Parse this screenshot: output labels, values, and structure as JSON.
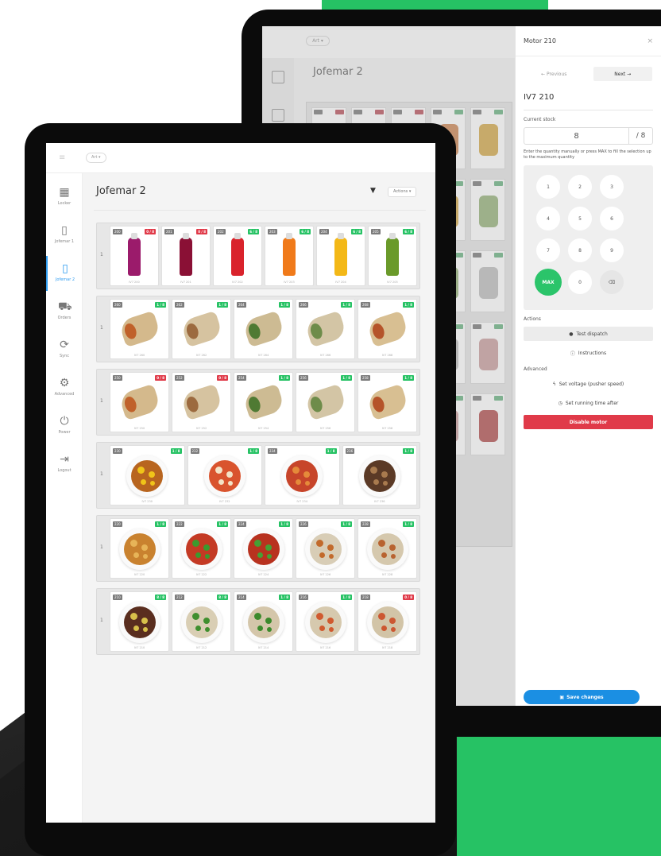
{
  "back_screen": {
    "location_pill": "Art ▾",
    "page_title": "Jofemar 2"
  },
  "drawer": {
    "title": "Motor 210",
    "close": "×",
    "previous": "← Previous",
    "next": "Next →",
    "motor_name": "IV7 210",
    "current_stock_label": "Current stock",
    "stock_value": "8",
    "stock_max": "/ 8",
    "help_text": "Enter the quantity manually or press MAX to fill the selection up to the maximum quantity",
    "keys": [
      "1",
      "2",
      "3",
      "4",
      "5",
      "6",
      "7",
      "8",
      "9",
      "MAX",
      "0",
      "⌫"
    ],
    "actions_label": "Actions",
    "test_dispatch": "Test dispatch",
    "instructions": "Instructions",
    "advanced_label": "Advanced",
    "set_voltage": "Set voltage (pusher speed)",
    "set_running_time": "Set running time after",
    "disable_motor": "Disable motor",
    "save_changes": "Save changes"
  },
  "front": {
    "location_pill": "Art ▾",
    "page_title": "Jofemar 2",
    "actions_button": "Actions ▾",
    "sidebar": [
      {
        "label": "Locker",
        "icon": "grid-icon",
        "glyph": "▦"
      },
      {
        "label": "Jofemar 1",
        "icon": "vending-icon",
        "glyph": "▯"
      },
      {
        "label": "Jofemar 2",
        "icon": "vending-icon",
        "glyph": "▯",
        "active": true
      },
      {
        "label": "Orders",
        "icon": "cart-icon",
        "glyph": "⛟"
      },
      {
        "label": "Sync",
        "icon": "sync-icon",
        "glyph": "⟳"
      },
      {
        "label": "Advanced",
        "icon": "gear-icon",
        "glyph": "⚙"
      },
      {
        "label": "Power",
        "icon": "power-icon",
        "glyph": "⏻"
      },
      {
        "label": "Logout",
        "icon": "logout-icon",
        "glyph": "⇥"
      }
    ],
    "rows": [
      {
        "number": "1",
        "cells": [
          {
            "id": "200",
            "stock": "0 / 8",
            "status": "red",
            "type": "bottle",
            "color": "#9b1b6b",
            "ref": "IV7 200"
          },
          {
            "id": "201",
            "stock": "0 / 8",
            "status": "red",
            "type": "bottle",
            "color": "#8a1035",
            "ref": "IV7 201"
          },
          {
            "id": "202",
            "stock": "6 / 8",
            "status": "green",
            "type": "bottle",
            "color": "#d9232c",
            "ref": "IV7 202"
          },
          {
            "id": "203",
            "stock": "6 / 8",
            "status": "green",
            "type": "bottle",
            "color": "#f07a1a",
            "ref": "IV7 203"
          },
          {
            "id": "204",
            "stock": "6 / 8",
            "status": "green",
            "type": "bottle",
            "color": "#f3b817",
            "ref": "IV7 204"
          },
          {
            "id": "205",
            "stock": "6 / 8",
            "status": "green",
            "type": "bottle",
            "color": "#6a9a2a",
            "ref": "IV7 205"
          }
        ]
      },
      {
        "number": "1",
        "cells": [
          {
            "id": "260",
            "stock": "1 / 8",
            "status": "green",
            "type": "wrap",
            "color": "#d4b98c",
            "fill": "#c0612a",
            "ref": "IV7 260"
          },
          {
            "id": "262",
            "stock": "1 / 8",
            "status": "green",
            "type": "wrap",
            "color": "#d6c3a0",
            "fill": "#9c6a3f",
            "ref": "IV7 262"
          },
          {
            "id": "264",
            "stock": "1 / 8",
            "status": "green",
            "type": "wrap",
            "color": "#cdbb93",
            "fill": "#4f7a33",
            "ref": "IV7 264"
          },
          {
            "id": "266",
            "stock": "1 / 8",
            "status": "green",
            "type": "wrap",
            "color": "#d3c5a5",
            "fill": "#6e8c4a",
            "ref": "IV7 266"
          },
          {
            "id": "268",
            "stock": "1 / 8",
            "status": "green",
            "type": "wrap",
            "color": "#d8bf92",
            "fill": "#b5542a",
            "ref": "IV7 268"
          }
        ]
      },
      {
        "number": "1",
        "cells": [
          {
            "id": "250",
            "stock": "0 / 8",
            "status": "red",
            "type": "wrap",
            "color": "#d4b98c",
            "fill": "#c0612a",
            "ref": "IV7 250"
          },
          {
            "id": "252",
            "stock": "0 / 8",
            "status": "red",
            "type": "wrap",
            "color": "#d6c3a0",
            "fill": "#9c6a3f",
            "ref": "IV7 252"
          },
          {
            "id": "254",
            "stock": "1 / 8",
            "status": "green",
            "type": "wrap",
            "color": "#cdbb93",
            "fill": "#4f7a33",
            "ref": "IV7 254"
          },
          {
            "id": "256",
            "stock": "1 / 8",
            "status": "green",
            "type": "wrap",
            "color": "#d3c5a5",
            "fill": "#6e8c4a",
            "ref": "IV7 256"
          },
          {
            "id": "258",
            "stock": "1 / 8",
            "status": "green",
            "type": "wrap",
            "color": "#d8bf92",
            "fill": "#b5542a",
            "ref": "IV7 258"
          }
        ]
      },
      {
        "number": "1",
        "cells": [
          {
            "id": "230",
            "stock": "1 / 8",
            "status": "green",
            "type": "bowl",
            "color": "#b8651f",
            "accent": "#f0c419",
            "ref": "IV7 230"
          },
          {
            "id": "232",
            "stock": "1 / 8",
            "status": "green",
            "type": "bowl",
            "color": "#d9542e",
            "accent": "#f3e3c6",
            "ref": "IV7 232"
          },
          {
            "id": "234",
            "stock": "1 / 8",
            "status": "green",
            "type": "bowl",
            "color": "#c7452a",
            "accent": "#e58a3a",
            "ref": "IV7 234"
          },
          {
            "id": "236",
            "stock": "1 / 8",
            "status": "green",
            "type": "bowl",
            "color": "#5b3a26",
            "accent": "#a87a4e",
            "ref": "IV7 236"
          }
        ]
      },
      {
        "number": "1",
        "cells": [
          {
            "id": "220",
            "stock": "1 / 8",
            "status": "green",
            "type": "bowl",
            "color": "#c9822f",
            "accent": "#e7b458",
            "ref": "IV7 220"
          },
          {
            "id": "222",
            "stock": "1 / 8",
            "status": "green",
            "type": "bowl",
            "color": "#c43a24",
            "accent": "#3c9a2e",
            "ref": "IV7 222"
          },
          {
            "id": "224",
            "stock": "1 / 8",
            "status": "green",
            "type": "bowl",
            "color": "#b8321f",
            "accent": "#45a034",
            "ref": "IV7 224"
          },
          {
            "id": "226",
            "stock": "1 / 8",
            "status": "green",
            "type": "bowl",
            "color": "#d8cdb6",
            "accent": "#c26a2b",
            "ref": "IV7 226"
          },
          {
            "id": "228",
            "stock": "1 / 8",
            "status": "green",
            "type": "bowl",
            "color": "#d5c8ad",
            "accent": "#b86330",
            "ref": "IV7 228"
          }
        ]
      },
      {
        "number": "1",
        "cells": [
          {
            "id": "210",
            "stock": "8 / 8",
            "status": "green",
            "type": "bowl",
            "color": "#5a2e1f",
            "accent": "#d8c04a",
            "ref": "IV7 210"
          },
          {
            "id": "212",
            "stock": "8 / 8",
            "status": "green",
            "type": "bowl",
            "color": "#d9ceb4",
            "accent": "#3f8f2e",
            "ref": "IV7 212"
          },
          {
            "id": "214",
            "stock": "1 / 8",
            "status": "green",
            "type": "bowl",
            "color": "#d4c6aa",
            "accent": "#3c8a2c",
            "ref": "IV7 214"
          },
          {
            "id": "216",
            "stock": "1 / 8",
            "status": "green",
            "type": "bowl",
            "color": "#d6c9ae",
            "accent": "#d05a2f",
            "ref": "IV7 216"
          },
          {
            "id": "218",
            "stock": "0 / 8",
            "status": "red",
            "type": "bowl",
            "color": "#d2c4a7",
            "accent": "#cc5731",
            "ref": "IV7 218"
          }
        ]
      }
    ]
  },
  "colors": {
    "green": "#26c264",
    "red": "#e03a49",
    "blue": "#1b8fe3"
  }
}
